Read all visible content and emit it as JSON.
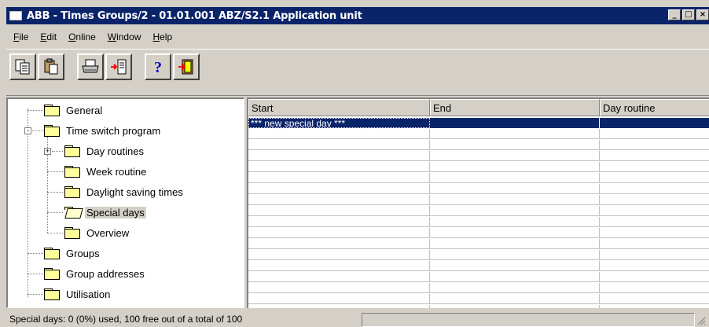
{
  "window": {
    "title": "ABB - Times Groups/2 - 01.01.001 ABZ/S2.1 Application unit",
    "buttons": [
      "_",
      "□",
      "×"
    ]
  },
  "menu": [
    {
      "label": "File",
      "accel": "F",
      "rest": "ile"
    },
    {
      "label": "Edit",
      "accel": "E",
      "rest": "dit"
    },
    {
      "label": "Online",
      "accel": "O",
      "rest": "nline"
    },
    {
      "label": "Window",
      "accel": "W",
      "rest": "indow"
    },
    {
      "label": "Help",
      "accel": "H",
      "rest": "elp"
    }
  ],
  "toolbar": [
    {
      "icon": "copy-icon",
      "glyph": "⎘"
    },
    {
      "icon": "paste-icon",
      "glyph": "📋"
    },
    {
      "icon": "print-icon",
      "glyph": "🖨"
    },
    {
      "icon": "import-icon",
      "glyph": "⇥"
    },
    {
      "icon": "help-icon",
      "glyph": "?"
    },
    {
      "icon": "exit-icon",
      "glyph": "⇤"
    }
  ],
  "tree": [
    {
      "label": "General",
      "level": 0
    },
    {
      "label": "Time switch program",
      "level": 0,
      "expander": "-"
    },
    {
      "label": "Day routines",
      "level": 1,
      "expander": "+"
    },
    {
      "label": "Week routine",
      "level": 1
    },
    {
      "label": "Daylight saving times",
      "level": 1
    },
    {
      "label": "Special days",
      "level": 1,
      "selected": true,
      "open": true
    },
    {
      "label": "Overview",
      "level": 1
    },
    {
      "label": "Groups",
      "level": 0
    },
    {
      "label": "Group addresses",
      "level": 0
    },
    {
      "label": "Utilisation",
      "level": 0
    }
  ],
  "grid": {
    "columns": [
      "Start",
      "End",
      "Day routine"
    ],
    "rows": [
      [
        "*** new special day ***",
        "",
        ""
      ]
    ]
  },
  "status": {
    "text": "Special days: 0 (0%) used, 100 free out of a total of 100"
  },
  "colors": {
    "titlebar": "#0a246a",
    "selection": "#0a246a",
    "face": "#d4d0c8"
  }
}
